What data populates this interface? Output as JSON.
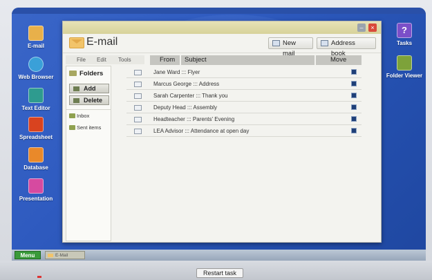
{
  "desktop_left": [
    {
      "label": "E-mail",
      "icon": "envelope-icon",
      "color": "#e8b04a"
    },
    {
      "label": "Web Browser",
      "icon": "globe-icon",
      "color": "#3aa0d8"
    },
    {
      "label": "Text Editor",
      "icon": "text-editor-icon",
      "color": "#2e9b8f"
    },
    {
      "label": "Spreadsheet",
      "icon": "spreadsheet-icon",
      "color": "#d9431f"
    },
    {
      "label": "Database",
      "icon": "database-icon",
      "color": "#e9892a"
    },
    {
      "label": "Presentation",
      "icon": "presentation-icon",
      "color": "#d64aa0"
    }
  ],
  "desktop_right": [
    {
      "label": "Tasks",
      "icon": "question-icon",
      "color": "#7b4fc8"
    },
    {
      "label": "Folder Viewer",
      "icon": "folder-viewer-icon",
      "color": "#7da23a"
    }
  ],
  "window": {
    "title": "E-mail",
    "new_mail": "New mail",
    "address_book": "Address book",
    "minimize": "–",
    "close": "×"
  },
  "menu": {
    "file": "File",
    "edit": "Edit",
    "tools": "Tools"
  },
  "folders": {
    "header": "Folders",
    "add": "Add",
    "delete": "Delete",
    "items": [
      "Inbox",
      "Sent items"
    ]
  },
  "columns": {
    "from": "From",
    "subject": "Subject",
    "move": "Move"
  },
  "messages": [
    "Jane Ward ::: Flyer",
    "Marcus George ::: Address",
    "Sarah Carpenter ::: Thank you",
    "Deputy Head ::: Assembly",
    "Headteacher ::: Parents' Evening",
    "LEA Advisor ::: Attendance at open day"
  ],
  "taskbar": {
    "menu": "Menu",
    "task": "E-Mail"
  },
  "restart": "Restart task",
  "colors": {
    "desktop": "#2f5bc0",
    "titlebar": "#d7d29a",
    "menu_button": "#3a9a3a"
  }
}
